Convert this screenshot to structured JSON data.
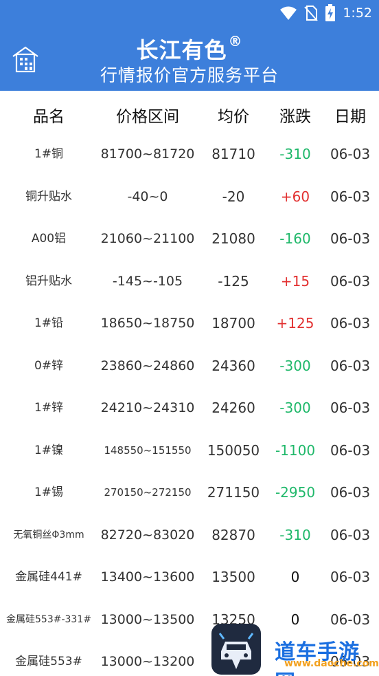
{
  "status_bar": {
    "time": "1:52"
  },
  "header": {
    "title": "长江有色",
    "reg_mark": "®",
    "subtitle": "行情报价官方服务平台"
  },
  "table": {
    "columns": [
      "品名",
      "价格区间",
      "均价",
      "涨跌",
      "日期"
    ],
    "rows": [
      {
        "name": "1#铜",
        "range": "81700~81720",
        "avg": "81710",
        "change": "-310",
        "date": "06-03"
      },
      {
        "name": "铜升贴水",
        "range": "-40~0",
        "avg": "-20",
        "change": "+60",
        "date": "06-03"
      },
      {
        "name": "A00铝",
        "range": "21060~21100",
        "avg": "21080",
        "change": "-160",
        "date": "06-03"
      },
      {
        "name": "铝升贴水",
        "range": "-145~-105",
        "avg": "-125",
        "change": "+15",
        "date": "06-03"
      },
      {
        "name": "1#铅",
        "range": "18650~18750",
        "avg": "18700",
        "change": "+125",
        "date": "06-03"
      },
      {
        "name": "0#锌",
        "range": "23860~24860",
        "avg": "24360",
        "change": "-300",
        "date": "06-03"
      },
      {
        "name": "1#锌",
        "range": "24210~24310",
        "avg": "24260",
        "change": "-300",
        "date": "06-03"
      },
      {
        "name": "1#镍",
        "range": "148550~151550",
        "avg": "150050",
        "change": "-1100",
        "date": "06-03"
      },
      {
        "name": "1#锡",
        "range": "270150~272150",
        "avg": "271150",
        "change": "-2950",
        "date": "06-03"
      },
      {
        "name": "无氧铜丝Φ3mm",
        "range": "82720~83020",
        "avg": "82870",
        "change": "-310",
        "date": "06-03"
      },
      {
        "name": "金属硅441#",
        "range": "13400~13600",
        "avg": "13500",
        "change": "0",
        "date": "06-03"
      },
      {
        "name": "金属硅553#-331#",
        "range": "13000~13500",
        "avg": "13250",
        "change": "0",
        "date": "06-03"
      },
      {
        "name": "金属硅553#",
        "range": "13000~13200",
        "avg": "",
        "change": "",
        "date": "06-03"
      }
    ]
  },
  "watermark": {
    "text": "道车手游网",
    "subtext": "www.daoche.com"
  },
  "colors": {
    "header_bg": "#3d7fdb",
    "up": "#e23030",
    "down": "#1fb86a"
  }
}
